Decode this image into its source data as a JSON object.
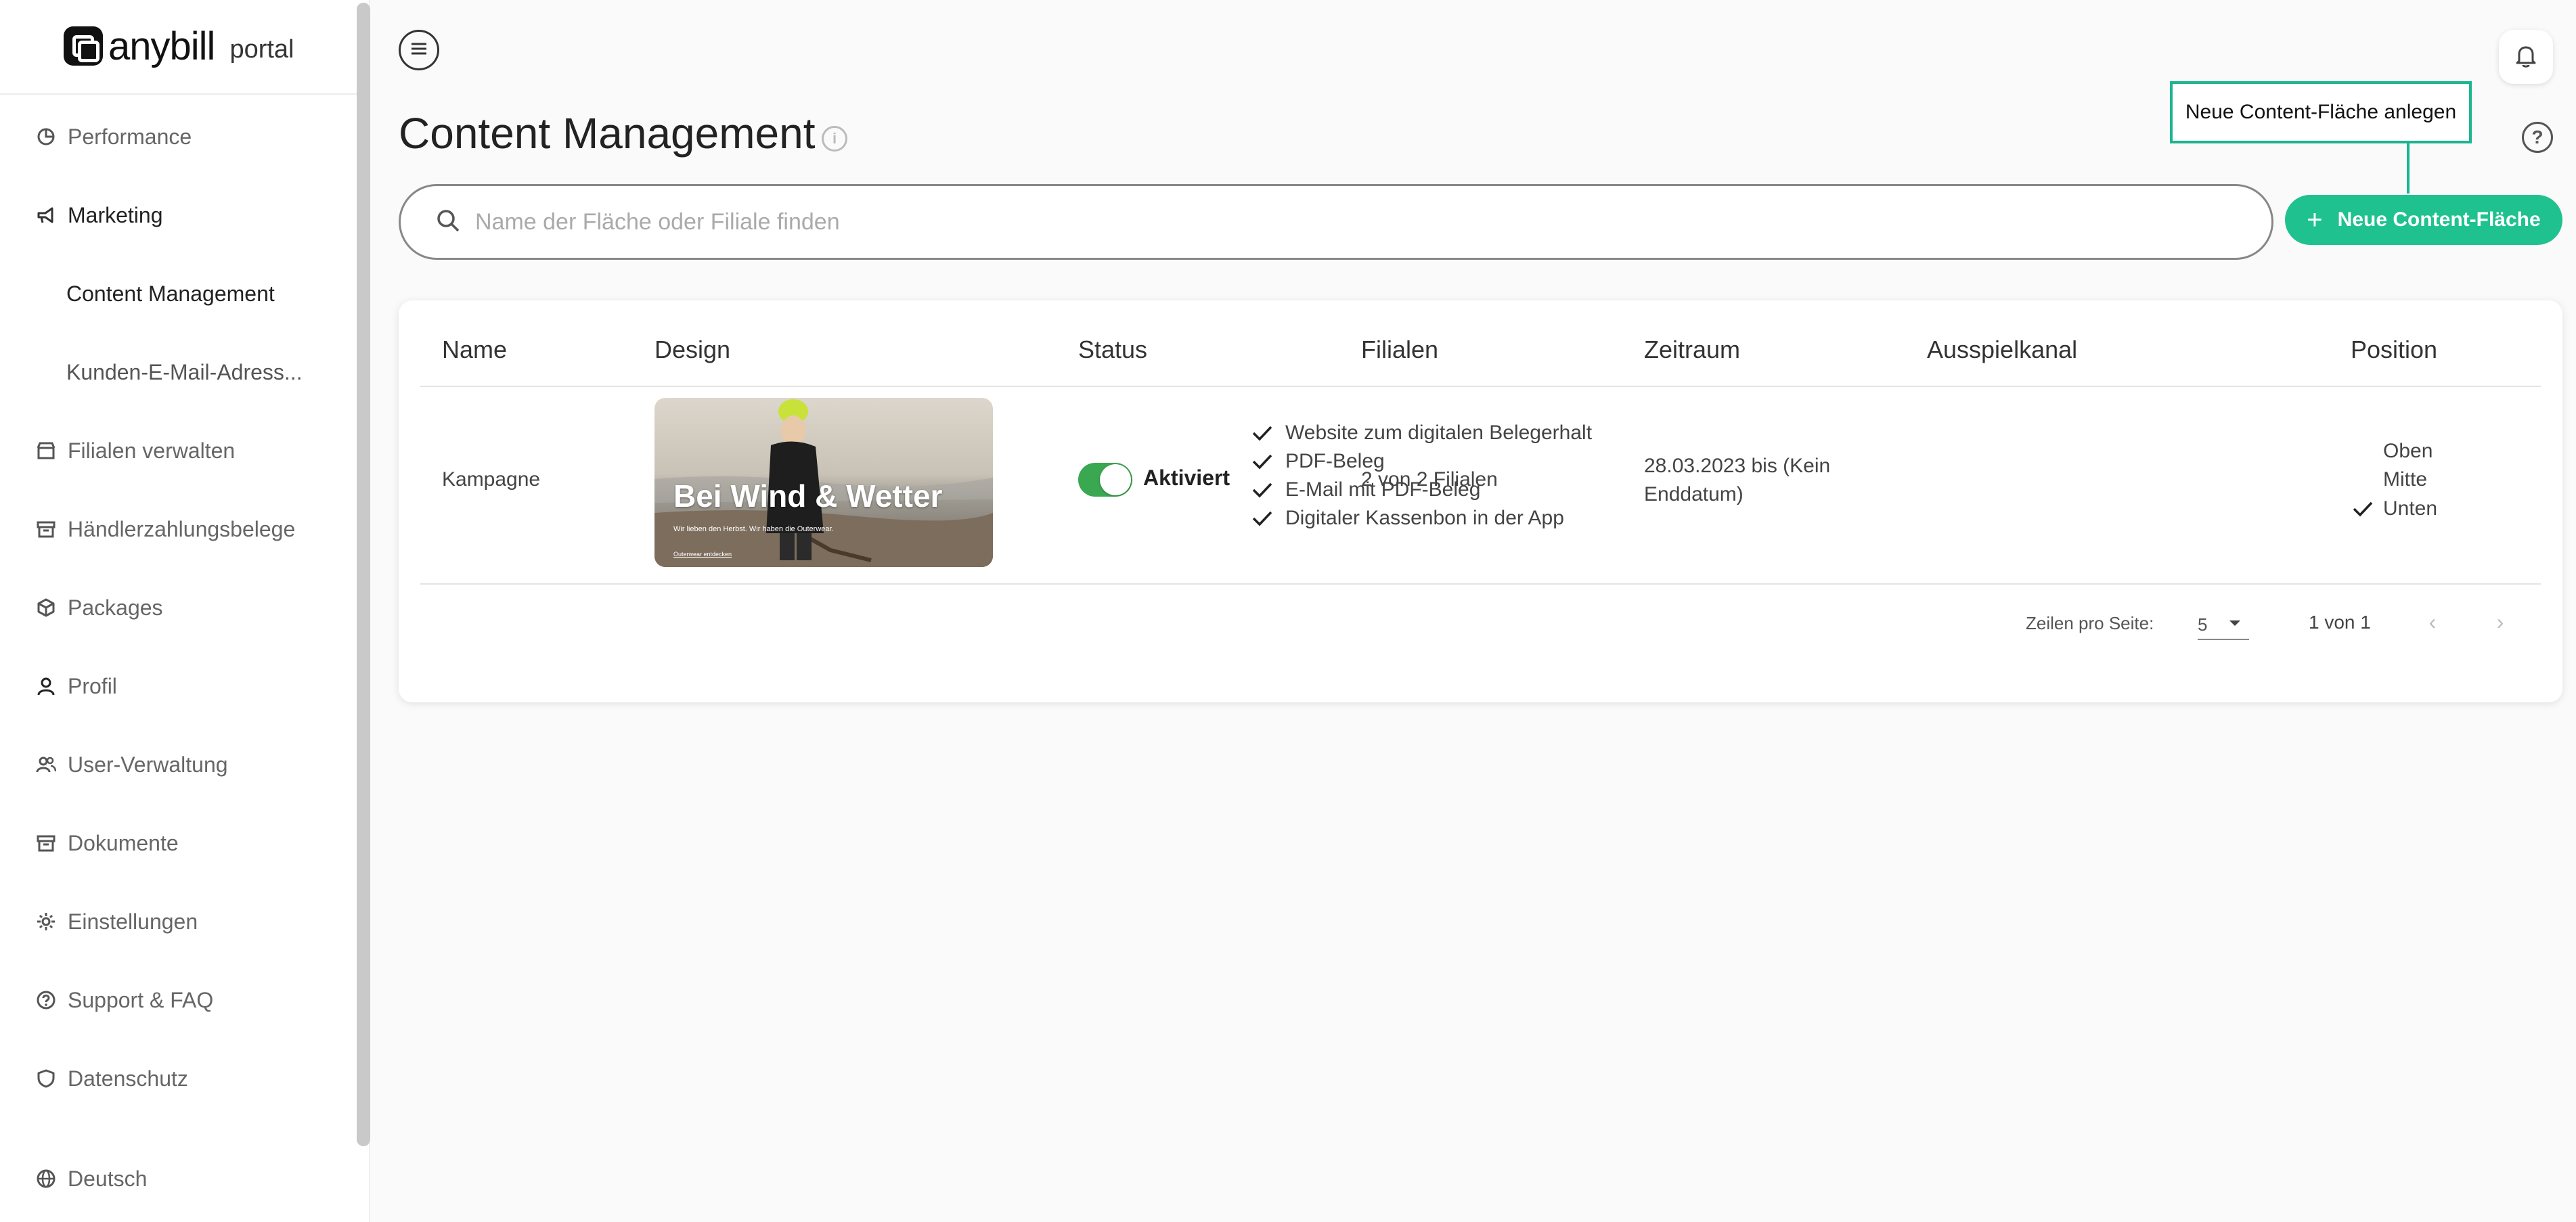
{
  "app": {
    "logo_text": "anybill",
    "logo_sub": "portal"
  },
  "sidebar": {
    "items": [
      {
        "label": "Performance",
        "icon": "chart-pie-icon"
      },
      {
        "label": "Marketing",
        "icon": "megaphone-icon"
      },
      {
        "label": "Content Management",
        "sub": true
      },
      {
        "label": "Kunden-E-Mail-Adress...",
        "sub": true
      },
      {
        "label": "Filialen verwalten",
        "icon": "store-icon"
      },
      {
        "label": "Händlerzahlungsbelege",
        "icon": "archive-icon"
      },
      {
        "label": "Packages",
        "icon": "package-icon"
      },
      {
        "label": "Profil",
        "icon": "person-icon"
      },
      {
        "label": "User-Verwaltung",
        "icon": "users-icon"
      },
      {
        "label": "Dokumente",
        "icon": "archive-icon"
      },
      {
        "label": "Einstellungen",
        "icon": "gear-icon"
      },
      {
        "label": "Support & FAQ",
        "icon": "help-icon"
      },
      {
        "label": "Datenschutz",
        "icon": "shield-icon"
      }
    ],
    "language": "Deutsch"
  },
  "header": {
    "title": "Content Management",
    "tooltip": "Neue Content-Fläche anlegen",
    "new_button": "Neue Content-Fläche",
    "help": "?"
  },
  "search": {
    "placeholder": "Name der Fläche oder Filiale finden",
    "value": ""
  },
  "table": {
    "columns": [
      "Name",
      "Design",
      "Status",
      "Filialen",
      "Zeitraum",
      "Ausspielkanal",
      "Position"
    ],
    "rows": [
      {
        "name": "Kampagne",
        "design": {
          "headline": "Bei Wind & Wetter",
          "subline": "Wir lieben den Herbst. Wir haben die Outerwear.",
          "link": "Outerwear entdecken"
        },
        "status": "Aktiviert",
        "status_on": true,
        "filialen": "2 von 2 Filialen",
        "zeitraum_line1": "28.03.2023 bis (Kein",
        "zeitraum_line2": "Enddatum)",
        "channels": [
          "Website zum digitalen Belegerhalt",
          "PDF-Beleg",
          "E-Mail mit PDF-Beleg",
          "Digitaler Kassenbon in der App"
        ],
        "positions": [
          {
            "label": "Oben",
            "checked": false
          },
          {
            "label": "Mitte",
            "checked": false
          },
          {
            "label": "Unten",
            "checked": true
          }
        ]
      }
    ]
  },
  "pagination": {
    "rows_label": "Zeilen pro Seite:",
    "rows_value": "5",
    "count": "1 von 1"
  },
  "colors": {
    "accent": "#1fc28f",
    "toggle_on": "#3aa751"
  }
}
